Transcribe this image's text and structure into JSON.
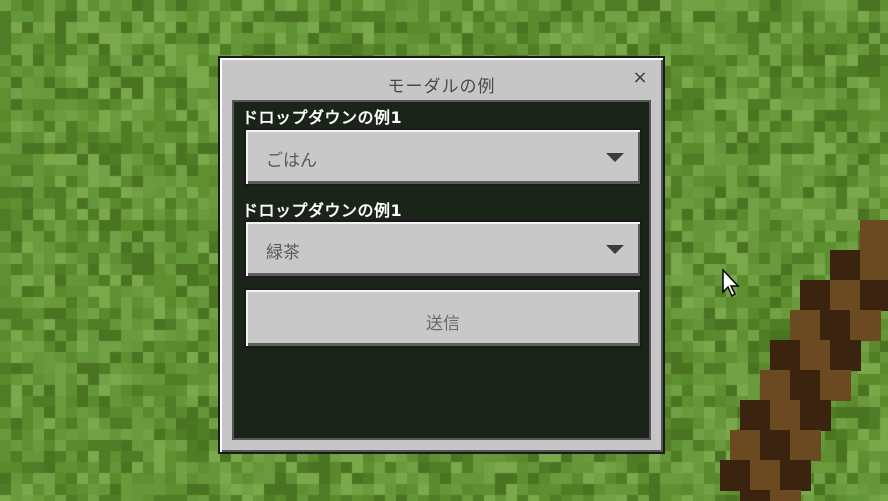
{
  "modal": {
    "title": "モーダルの例",
    "close": "×"
  },
  "form": {
    "dropdown1": {
      "label": "ドロップダウンの例1",
      "value": "ごはん"
    },
    "dropdown2": {
      "label": "ドロップダウンの例1",
      "value": "緑茶"
    },
    "submit_label": "送信"
  },
  "colors": {
    "grass_base": "#5a8a2c",
    "panel": "#c6c6c6",
    "content_bg": "#0e180c",
    "stick_dark": "#3a2410",
    "stick_light": "#6b4a22"
  },
  "icons": {
    "close": "close-icon",
    "dropdown_arrow": "caret-down-icon",
    "cursor": "mouse-cursor-icon"
  }
}
